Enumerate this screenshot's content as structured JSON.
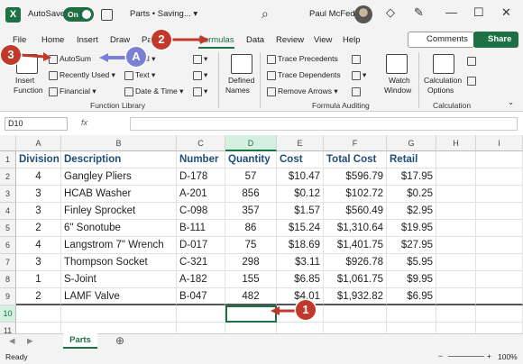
{
  "titlebar": {
    "autosave_label": "AutoSave",
    "autosave_state": "On",
    "doc_title": "Parts • Saving... ▾",
    "user_name": "Paul McFedries"
  },
  "menu": {
    "tabs": [
      "File",
      "Home",
      "Insert",
      "Draw",
      "Pa",
      "Formulas",
      "Data",
      "Review",
      "View",
      "Help"
    ],
    "active": "Formulas",
    "comments": "Comments",
    "share": "Share"
  },
  "ribbon": {
    "insert_function": [
      "Insert",
      "Function"
    ],
    "autosum": "AutoSum",
    "recently_used": "Recently Used",
    "financial": "Financial",
    "logical": "ical",
    "text": "Text",
    "date_time": "Date & Time",
    "defined_names": [
      "Defined",
      "Names"
    ],
    "trace_precedents": "Trace Precedents",
    "trace_dependents": "Trace Dependents",
    "remove_arrows": "Remove Arrows",
    "watch_window": [
      "Watch",
      "Window"
    ],
    "calc_options": [
      "Calculation",
      "Options"
    ],
    "group_function_library": "Function Library",
    "group_formula_auditing": "Formula Auditing",
    "group_calculation": "Calculation"
  },
  "formula_bar": {
    "name_box": "D10",
    "fx": "fx"
  },
  "sheet": {
    "columns": [
      "A",
      "B",
      "C",
      "D",
      "E",
      "F",
      "G",
      "H",
      "I"
    ],
    "rows": [
      "1",
      "2",
      "3",
      "4",
      "5",
      "6",
      "7",
      "8",
      "9",
      "10",
      "11"
    ],
    "header": [
      "Division",
      "Description",
      "Number",
      "Quantity",
      "Cost",
      "Total Cost",
      "Retail"
    ],
    "data": [
      [
        "4",
        "Gangley Pliers",
        "D-178",
        "57",
        "$10.47",
        "$596.79",
        "$17.95"
      ],
      [
        "3",
        "HCAB Washer",
        "A-201",
        "856",
        "$0.12",
        "$102.72",
        "$0.25"
      ],
      [
        "3",
        "Finley Sprocket",
        "C-098",
        "357",
        "$1.57",
        "$560.49",
        "$2.95"
      ],
      [
        "2",
        "6\" Sonotube",
        "B-111",
        "86",
        "$15.24",
        "$1,310.64",
        "$19.95"
      ],
      [
        "4",
        "Langstrom 7\" Wrench",
        "D-017",
        "75",
        "$18.69",
        "$1,401.75",
        "$27.95"
      ],
      [
        "3",
        "Thompson Socket",
        "C-321",
        "298",
        "$3.11",
        "$926.78",
        "$5.95"
      ],
      [
        "1",
        "S-Joint",
        "A-182",
        "155",
        "$6.85",
        "$1,061.75",
        "$9.95"
      ],
      [
        "2",
        "LAMF Valve",
        "B-047",
        "482",
        "$4.01",
        "$1,932.82",
        "$6.95"
      ]
    ]
  },
  "sheet_tab": "Parts",
  "status": {
    "ready": "Ready",
    "zoom": "100%"
  },
  "callouts": {
    "one": "1",
    "two": "2",
    "three": "3",
    "a": "A"
  },
  "colors": {
    "accent": "#1e7145",
    "callout": "#c0392b",
    "callout_alt": "#7b7fd6",
    "header_text": "#1f4e79"
  }
}
